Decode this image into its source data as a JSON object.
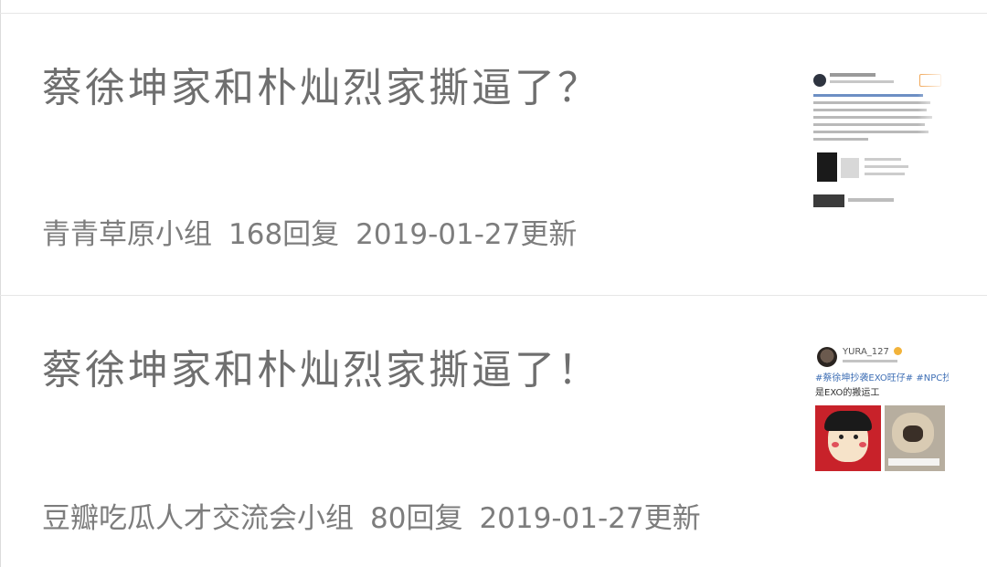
{
  "posts": [
    {
      "title": "蔡徐坤家和朴灿烈家撕逼了？",
      "group": "青青草原小组",
      "replies": "168回复",
      "updated": "2019-01-27更新",
      "thumbnail": {
        "kind": "weibo-post-screenshot"
      }
    },
    {
      "title": "蔡徐坤家和朴灿烈家撕逼了！",
      "group": "豆瓣吃瓜人才交流会小组",
      "replies": "80回复",
      "updated": "2019-01-27更新",
      "thumbnail": {
        "kind": "weibo-post-screenshot",
        "username": "YURA_127",
        "tags": "#蔡徐坤抄袭EXO旺仔#  #NPC抄袭",
        "text": "是EXO的搬运工"
      }
    }
  ],
  "colors": {
    "title": "#6f6f6f",
    "meta": "#7d7d7d",
    "divider": "#e6e6e6"
  }
}
